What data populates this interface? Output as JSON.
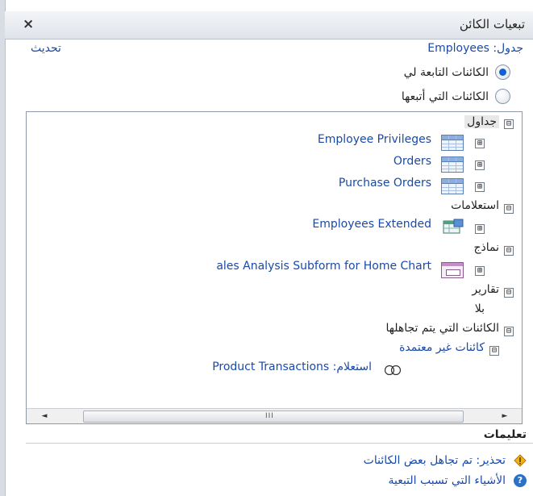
{
  "panel": {
    "title": "تبعيات الكائن",
    "close_glyph": "×",
    "table_line": "جدول: Employees",
    "refresh_label": "تحديث",
    "radio_options": [
      {
        "label": "الكائنات التابعة لي",
        "selected": true
      },
      {
        "label": "الكائنات التي أتبعها",
        "selected": false
      }
    ]
  },
  "tree": {
    "tables_header": "جداول",
    "tables": [
      "Employee Privileges",
      "Orders",
      "Purchase Orders"
    ],
    "queries_header": "استعلامات",
    "queries": [
      "Employees Extended"
    ],
    "forms_header": "نماذج",
    "forms": [
      "ales Analysis Subform for Home Chart"
    ],
    "reports_header": "تقارير",
    "reports_none": "بلا",
    "ignored_header": "الكائنات التي يتم تجاهلها",
    "unsupported_header": "كائنات غير معتمدة",
    "unsupported_item": "استعلام: Product Transactions",
    "expander_minus": "⊟",
    "expander_plus": "⊞"
  },
  "scrollbar": {
    "left_arrow": "◄",
    "right_arrow": "►",
    "grip": "III"
  },
  "help": {
    "header": "تعليمات",
    "warning_text": "تحذير: تم تجاهل بعض الكائنات",
    "info_text": "الأشياء التي تسبب التبعية",
    "info_glyph": "?"
  },
  "colors": {
    "link": "#1a4aa8",
    "radio_dot": "#1560d4",
    "warning": "#f2b21a",
    "help": "#2a72c8"
  },
  "icons": [
    "close-icon",
    "table-icon",
    "query-icon",
    "form-icon",
    "ring-icon",
    "warning-icon",
    "help-icon"
  ]
}
